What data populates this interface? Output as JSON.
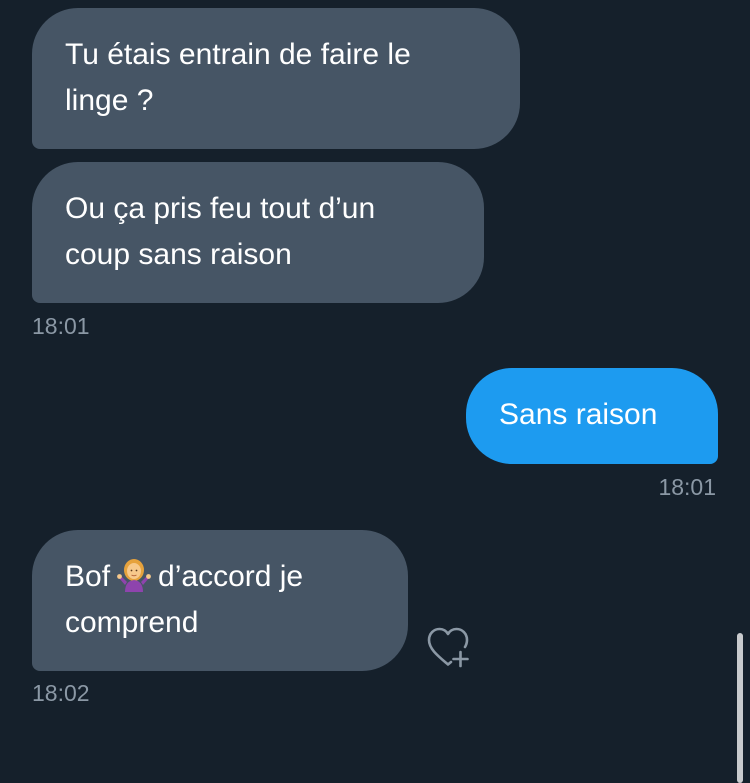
{
  "messages": [
    {
      "direction": "incoming",
      "lines": [
        "Tu étais entrain de faire le",
        "linge ?"
      ]
    },
    {
      "direction": "incoming",
      "lines": [
        "Ou ça pris feu tout d’un",
        "coup sans raison"
      ],
      "time": "18:01"
    },
    {
      "direction": "outgoing",
      "lines": [
        "Sans raison"
      ],
      "time": "18:01"
    },
    {
      "direction": "incoming",
      "line1_before_emoji": "Bof",
      "emoji": "woman-shrugging-emoji",
      "line1_after_emoji": "d’accord je",
      "line2": "comprend",
      "time": "18:02"
    }
  ],
  "icons": {
    "react": "heart-plus-icon"
  },
  "colors": {
    "background": "#15202b",
    "incoming_bubble": "#465565",
    "outgoing_bubble": "#1d9bf0",
    "timestamp": "#8b98a5"
  }
}
